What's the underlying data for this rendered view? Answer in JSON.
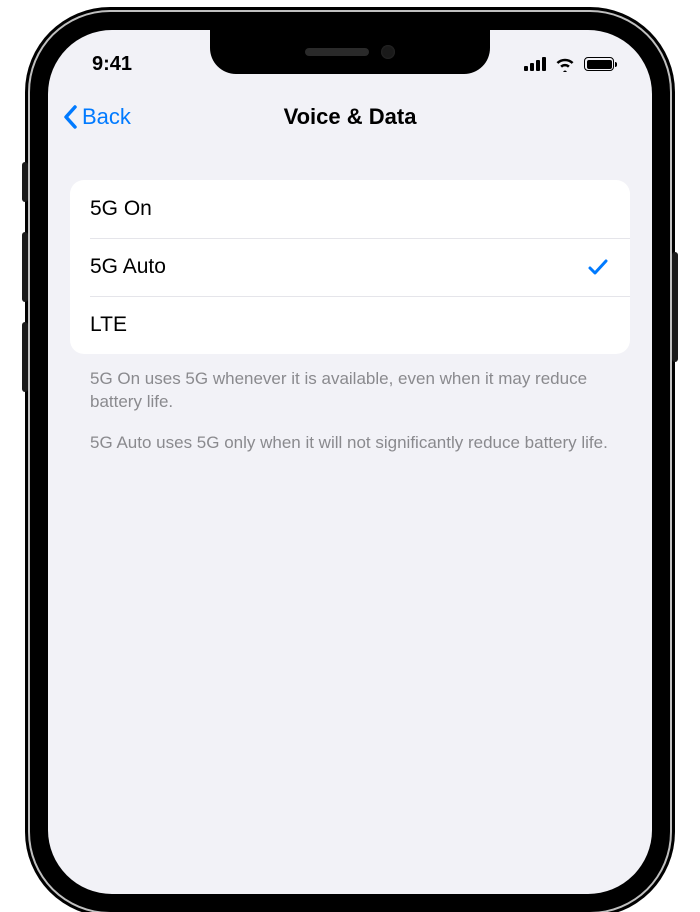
{
  "status": {
    "time": "9:41"
  },
  "nav": {
    "back_label": "Back",
    "title": "Voice & Data"
  },
  "options": [
    {
      "label": "5G On",
      "selected": false
    },
    {
      "label": "5G Auto",
      "selected": true
    },
    {
      "label": "LTE",
      "selected": false
    }
  ],
  "footer": {
    "line1": "5G On uses 5G whenever it is available, even when it may reduce battery life.",
    "line2": "5G Auto uses 5G only when it will not significantly reduce battery life."
  }
}
